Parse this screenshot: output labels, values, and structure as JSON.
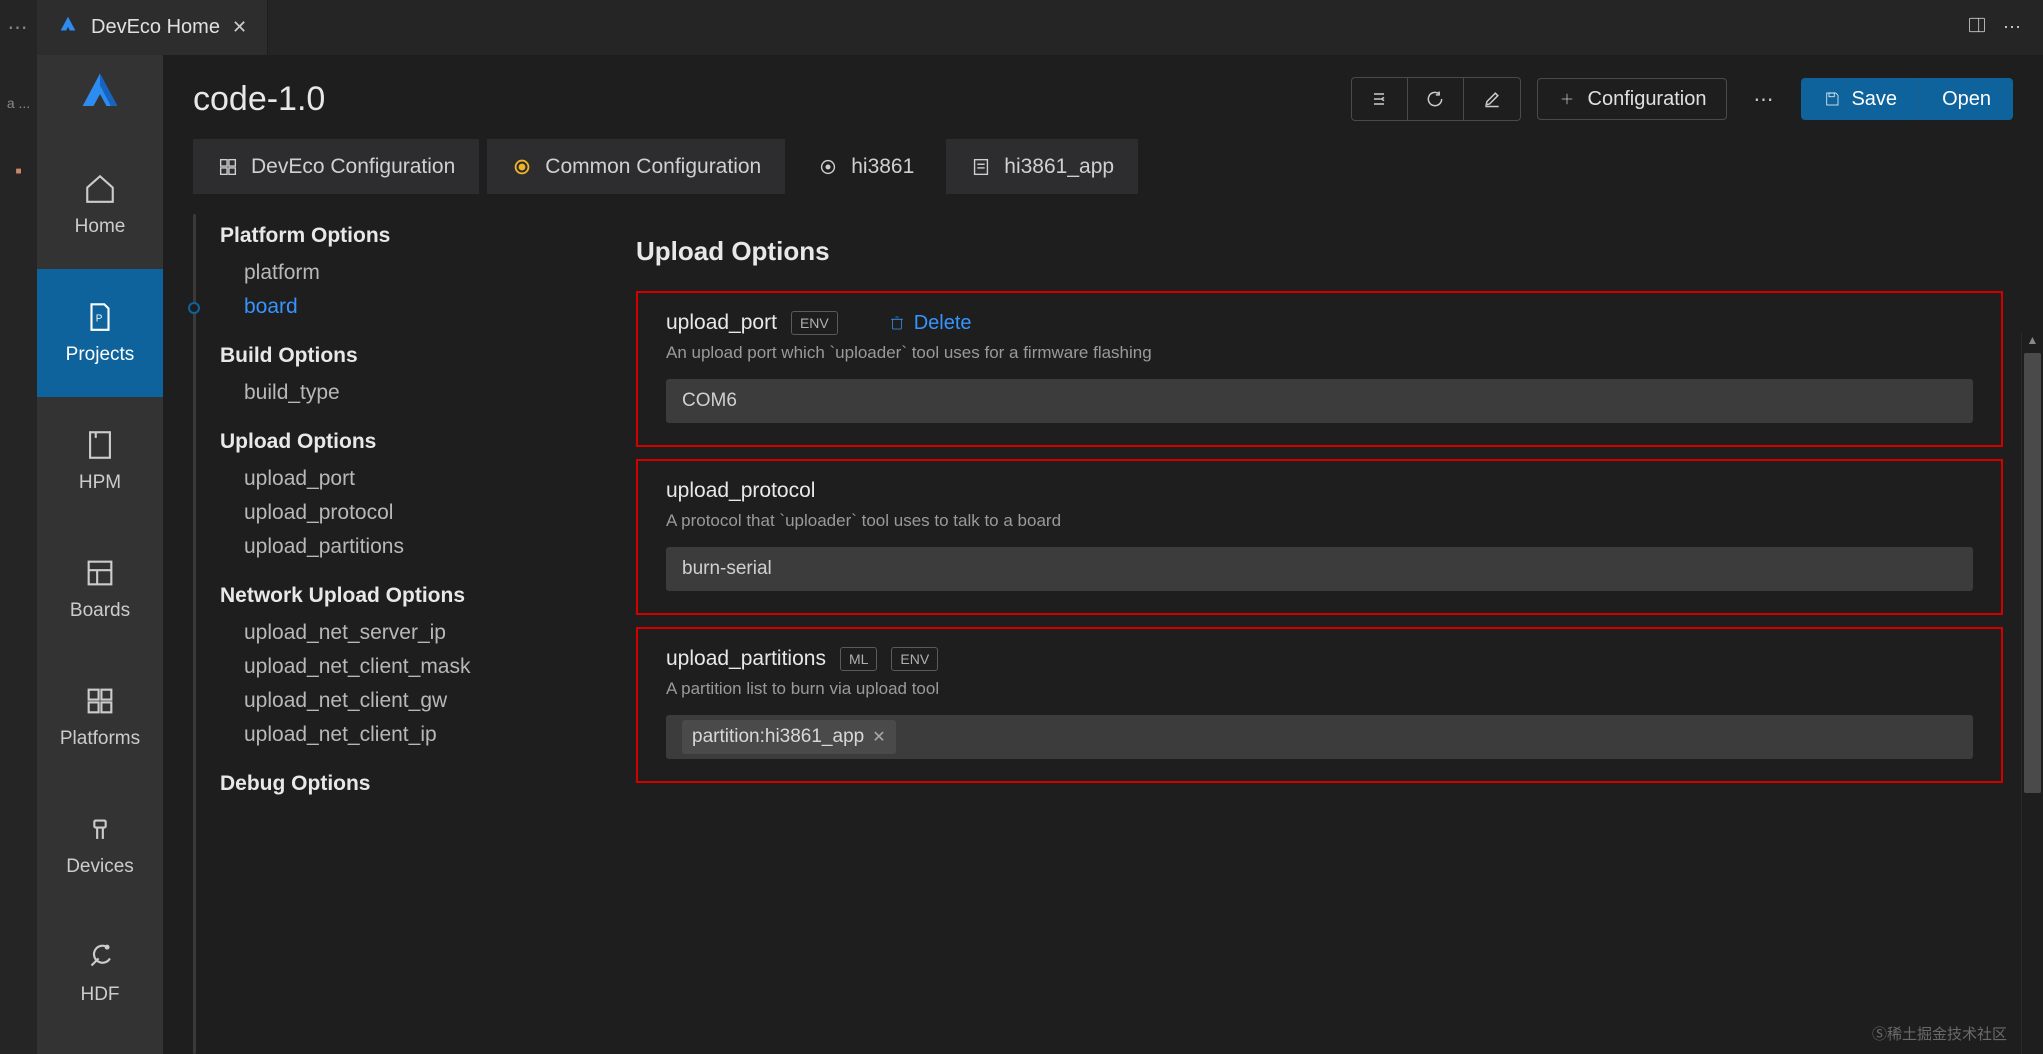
{
  "tab": {
    "title": "DevEco Home"
  },
  "activity": {
    "home": "Home",
    "projects": "Projects",
    "hpm": "HPM",
    "boards": "Boards",
    "platforms": "Platforms",
    "devices": "Devices",
    "hdf": "HDF"
  },
  "header": {
    "project": "code-1.0",
    "configuration": "Configuration",
    "save": "Save",
    "open": "Open"
  },
  "subtabs": {
    "deveco": "DevEco Configuration",
    "common": "Common Configuration",
    "hi3861": "hi3861",
    "hi3861_app": "hi3861_app"
  },
  "tree": {
    "platform_options": "Platform Options",
    "platform": "platform",
    "board": "board",
    "build_options": "Build Options",
    "build_type": "build_type",
    "upload_options": "Upload Options",
    "upload_port": "upload_port",
    "upload_protocol": "upload_protocol",
    "upload_partitions": "upload_partitions",
    "network_upload_options": "Network Upload Options",
    "upload_net_server_ip": "upload_net_server_ip",
    "upload_net_client_mask": "upload_net_client_mask",
    "upload_net_client_gw": "upload_net_client_gw",
    "upload_net_client_ip": "upload_net_client_ip",
    "debug_options": "Debug Options"
  },
  "options": {
    "heading": "Upload Options",
    "delete": "Delete",
    "badge_env": "ENV",
    "badge_ml": "ML",
    "upload_port": {
      "title": "upload_port",
      "desc": "An upload port which `uploader` tool uses for a firmware flashing",
      "value": "COM6"
    },
    "upload_protocol": {
      "title": "upload_protocol",
      "desc": "A protocol that `uploader` tool uses to talk to a board",
      "value": "burn-serial"
    },
    "upload_partitions": {
      "title": "upload_partitions",
      "desc": "A partition list to burn via upload tool",
      "token": "partition:hi3861_app"
    }
  },
  "watermark": "Ⓢ稀土掘金技术社区"
}
